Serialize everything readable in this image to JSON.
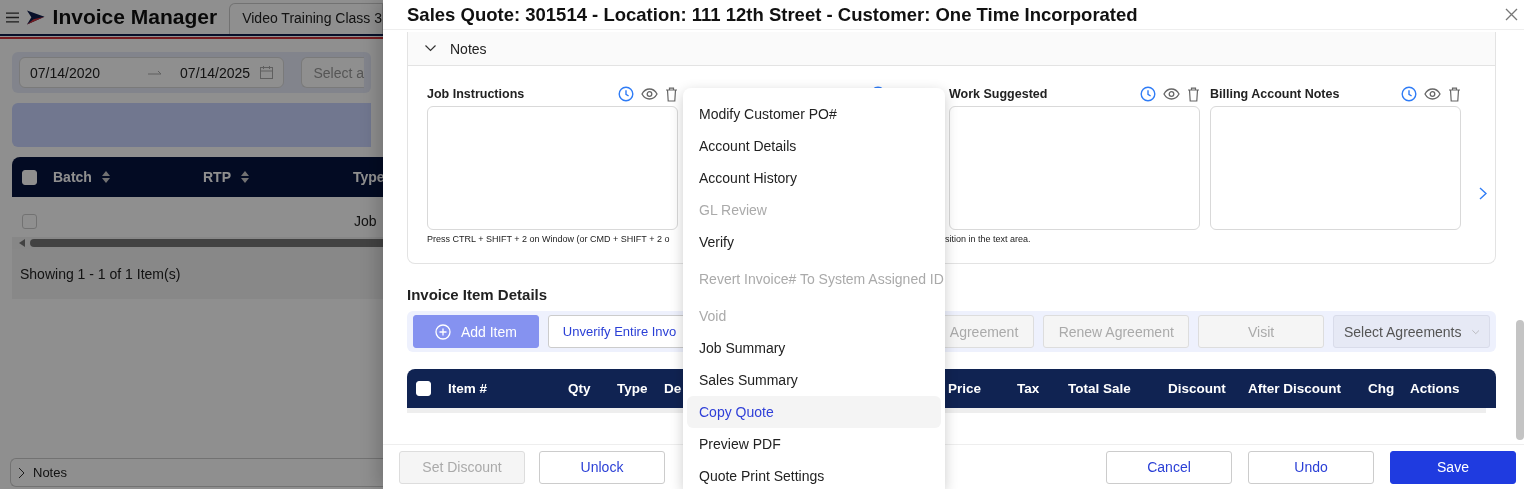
{
  "background": {
    "app_title": "Invoice Manager",
    "tab": "Video Training Class 3",
    "date_range": {
      "start": "07/14/2020",
      "end": "07/14/2025"
    },
    "select_placeholder": "Select a",
    "table": {
      "select_all": false,
      "columns": [
        "Batch",
        "RTP",
        "Type"
      ],
      "rows": [
        {
          "checked": false,
          "type": "Job"
        }
      ]
    },
    "pagination": "Showing 1 - 1 of 1 Item(s)",
    "notes_bar": {
      "label": "Notes",
      "expanded": false
    }
  },
  "drawer": {
    "title": "Sales Quote: 301514 - Location: 111 12th Street - Customer: One Time Incorporated",
    "notes": {
      "label": "Notes",
      "expanded": true,
      "fields": [
        {
          "label": "Job Instructions"
        },
        {
          "label": "Work Suggested"
        },
        {
          "label": "Billing Account Notes"
        }
      ],
      "hint_start": "Press CTRL + SHIFT + 2 on Window (or CMD + SHIFT + 2 o",
      "hint_end": "sition in the text area."
    },
    "items_heading": "Invoice Item Details",
    "toolbar": [
      {
        "label": "Add Item",
        "kind": "primary"
      },
      {
        "label": "Unverify Entire Invo",
        "kind": "default"
      },
      {
        "label": "Agreement",
        "kind": "disabled"
      },
      {
        "label": "Renew Agreement",
        "kind": "disabled"
      },
      {
        "label": "Visit",
        "kind": "disabled"
      },
      {
        "label": "Select Agreements",
        "kind": "select"
      }
    ],
    "items_table": {
      "select_all": false,
      "columns": [
        "Item #",
        "Qty",
        "Type",
        "De",
        "Price",
        "Tax",
        "Total Sale",
        "Discount",
        "After Discount",
        "Chg",
        "Actions"
      ]
    },
    "footer": [
      {
        "label": "Set Discount",
        "kind": "disabled"
      },
      {
        "label": "Unlock",
        "kind": "default"
      },
      {
        "label": "Cancel",
        "kind": "default"
      },
      {
        "label": "Undo",
        "kind": "default"
      },
      {
        "label": "Save",
        "kind": "primary"
      }
    ]
  },
  "menu": [
    {
      "label": "Modify Customer PO#",
      "disabled": false,
      "selected": false
    },
    {
      "label": "Account Details",
      "disabled": false,
      "selected": false
    },
    {
      "label": "Account History",
      "disabled": false,
      "selected": false
    },
    {
      "label": "GL Review",
      "disabled": true,
      "selected": false
    },
    {
      "label": "Verify",
      "disabled": false,
      "selected": false
    },
    {
      "label": "Revert Invoice# To System Assigned ID",
      "disabled": true,
      "selected": false
    },
    {
      "label": "Void",
      "disabled": true,
      "selected": false
    },
    {
      "label": "Job Summary",
      "disabled": false,
      "selected": false
    },
    {
      "label": "Sales Summary",
      "disabled": false,
      "selected": false
    },
    {
      "label": "Copy Quote",
      "disabled": false,
      "selected": true
    },
    {
      "label": "Preview PDF",
      "disabled": false,
      "selected": false
    },
    {
      "label": "Quote Print Settings",
      "disabled": false,
      "selected": false
    }
  ]
}
